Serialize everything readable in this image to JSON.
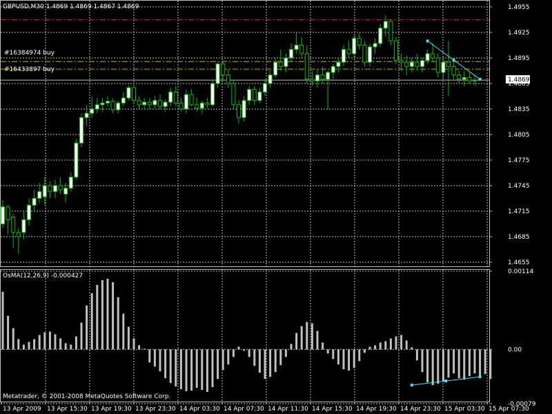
{
  "header": {
    "symbol_text": "GBPUSD,M30  1.4869 1.4869 1.4867 1.4869"
  },
  "orders": [
    {
      "label": "#16384974 buy",
      "price": 1.48905
    },
    {
      "label": "#16433897 buy",
      "price": 1.48815
    }
  ],
  "levels": {
    "red_line": 1.494,
    "current_price": 1.4869,
    "current_price_label": "1.4869"
  },
  "indicator": {
    "title": "OsMA(12,26,9) -0.000427"
  },
  "copyright": "Metatrader, © 2001-2008 MetaQuotes Software Corp.",
  "colors": {
    "background": "#000000",
    "grid": "#c0c0c0",
    "bull_fill": "#ffffff",
    "bear_fill": "#000000",
    "candle_outline": "#00c000",
    "red_level": "#ff0000",
    "order_line": "#00c000",
    "histogram": "#c0c0c0",
    "trend": "#40e0ff"
  },
  "chart_data": [
    {
      "type": "candlestick",
      "symbol": "GBPUSD",
      "timeframe": "M30",
      "ylim": [
        1.4655,
        1.4955
      ],
      "y_ticks": [
        "1.4955",
        "1.4925",
        "1.4895",
        "1.4865",
        "1.4835",
        "1.4805",
        "1.4775",
        "1.4745",
        "1.4715",
        "1.4685",
        "1.4655"
      ],
      "x_ticks": [
        "13 Apr 2009",
        "13 Apr 15:30",
        "13 Apr 19:30",
        "13 Apr 23:30",
        "14 Apr 03:30",
        "14 Apr 07:30",
        "14 Apr 11:30",
        "14 Apr 15:30",
        "14 Apr 19:30",
        "14 Apr 23:30",
        "15 Apr 03:30",
        "15 Apr 07:30"
      ],
      "ohlc": [
        [
          1.47,
          1.4728,
          1.4695,
          1.472
        ],
        [
          1.472,
          1.4722,
          1.4688,
          1.4705
        ],
        [
          1.4708,
          1.4712,
          1.4672,
          1.469
        ],
        [
          1.469,
          1.4695,
          1.4665,
          1.4685
        ],
        [
          1.469,
          1.4715,
          1.4682,
          1.4705
        ],
        [
          1.4705,
          1.473,
          1.4698,
          1.4722
        ],
        [
          1.4722,
          1.474,
          1.4715,
          1.473
        ],
        [
          1.473,
          1.4748,
          1.4725,
          1.4738
        ],
        [
          1.4732,
          1.4755,
          1.4722,
          1.4745
        ],
        [
          1.4745,
          1.475,
          1.473,
          1.4738
        ],
        [
          1.4738,
          1.4752,
          1.473,
          1.4745
        ],
        [
          1.4745,
          1.4755,
          1.4735,
          1.474
        ],
        [
          1.4735,
          1.4748,
          1.4725,
          1.4742
        ],
        [
          1.4742,
          1.476,
          1.4738,
          1.4755
        ],
        [
          1.4755,
          1.48,
          1.4752,
          1.4795
        ],
        [
          1.4795,
          1.483,
          1.479,
          1.4825
        ],
        [
          1.4825,
          1.484,
          1.4815,
          1.483
        ],
        [
          1.483,
          1.485,
          1.4825,
          1.4835
        ],
        [
          1.4835,
          1.4848,
          1.483,
          1.484
        ],
        [
          1.484,
          1.4848,
          1.4832,
          1.4842
        ],
        [
          1.4842,
          1.485,
          1.4838,
          1.4844
        ],
        [
          1.4844,
          1.4848,
          1.483,
          1.4834
        ],
        [
          1.4834,
          1.4845,
          1.483,
          1.4842
        ],
        [
          1.4842,
          1.4855,
          1.4838,
          1.4848
        ],
        [
          1.4848,
          1.4862,
          1.4845,
          1.486
        ],
        [
          1.486,
          1.4865,
          1.4842,
          1.4845
        ],
        [
          1.4845,
          1.485,
          1.4835,
          1.484
        ],
        [
          1.484,
          1.4848,
          1.4835,
          1.4843
        ],
        [
          1.4843,
          1.4848,
          1.4835,
          1.484
        ],
        [
          1.484,
          1.485,
          1.4836,
          1.4845
        ],
        [
          1.4845,
          1.4852,
          1.4835,
          1.4838
        ],
        [
          1.4838,
          1.4846,
          1.4832,
          1.4843
        ],
        [
          1.4843,
          1.486,
          1.4838,
          1.4855
        ],
        [
          1.4855,
          1.4862,
          1.4838,
          1.4842
        ],
        [
          1.4842,
          1.4848,
          1.4832,
          1.4835
        ],
        [
          1.4835,
          1.4858,
          1.483,
          1.4852
        ],
        [
          1.4852,
          1.4858,
          1.4838,
          1.484
        ],
        [
          1.484,
          1.4848,
          1.4832,
          1.4836
        ],
        [
          1.4836,
          1.4845,
          1.483,
          1.4842
        ],
        [
          1.4842,
          1.4848,
          1.4836,
          1.484
        ],
        [
          1.484,
          1.487,
          1.4838,
          1.4865
        ],
        [
          1.4865,
          1.489,
          1.486,
          1.4888
        ],
        [
          1.4888,
          1.4892,
          1.487,
          1.4875
        ],
        [
          1.4875,
          1.4882,
          1.486,
          1.4865
        ],
        [
          1.4865,
          1.487,
          1.4835,
          1.484
        ],
        [
          1.484,
          1.4845,
          1.4818,
          1.4825
        ],
        [
          1.4825,
          1.485,
          1.482,
          1.4845
        ],
        [
          1.4845,
          1.4862,
          1.484,
          1.4858
        ],
        [
          1.4858,
          1.4862,
          1.484,
          1.4845
        ],
        [
          1.4845,
          1.486,
          1.4842,
          1.4855
        ],
        [
          1.4855,
          1.487,
          1.485,
          1.4865
        ],
        [
          1.4865,
          1.488,
          1.486,
          1.4875
        ],
        [
          1.4875,
          1.4895,
          1.4872,
          1.489
        ],
        [
          1.489,
          1.4905,
          1.488,
          1.4885
        ],
        [
          1.4885,
          1.49,
          1.4878,
          1.4895
        ],
        [
          1.4895,
          1.4912,
          1.489,
          1.4905
        ],
        [
          1.4905,
          1.4925,
          1.49,
          1.491
        ],
        [
          1.491,
          1.492,
          1.4895,
          1.49
        ],
        [
          1.49,
          1.491,
          1.4865,
          1.487
        ],
        [
          1.487,
          1.488,
          1.4862,
          1.4868
        ],
        [
          1.4868,
          1.4882,
          1.486,
          1.4875
        ],
        [
          1.4875,
          1.4885,
          1.4865,
          1.487
        ],
        [
          1.487,
          1.488,
          1.4835,
          1.4878
        ],
        [
          1.4878,
          1.4888,
          1.487,
          1.4885
        ],
        [
          1.4885,
          1.4895,
          1.4878,
          1.489
        ],
        [
          1.489,
          1.491,
          1.4885,
          1.4905
        ],
        [
          1.4905,
          1.4915,
          1.4895,
          1.49
        ],
        [
          1.49,
          1.4922,
          1.4895,
          1.4918
        ],
        [
          1.4918,
          1.4925,
          1.4905,
          1.491
        ],
        [
          1.491,
          1.4915,
          1.4885,
          1.489
        ],
        [
          1.489,
          1.4912,
          1.4885,
          1.4908
        ],
        [
          1.4908,
          1.4918,
          1.49,
          1.4912
        ],
        [
          1.4912,
          1.4935,
          1.4908,
          1.493
        ],
        [
          1.493,
          1.4945,
          1.492,
          1.4938
        ],
        [
          1.4938,
          1.494,
          1.491,
          1.4915
        ],
        [
          1.4915,
          1.492,
          1.4888,
          1.4892
        ],
        [
          1.4892,
          1.49,
          1.488,
          1.489
        ],
        [
          1.489,
          1.4898,
          1.4875,
          1.4885
        ],
        [
          1.4885,
          1.4895,
          1.4878,
          1.489
        ],
        [
          1.489,
          1.49,
          1.488,
          1.4885
        ],
        [
          1.4885,
          1.4895,
          1.4878,
          1.4892
        ],
        [
          1.4892,
          1.4905,
          1.4888,
          1.49
        ],
        [
          1.49,
          1.4912,
          1.489,
          1.4895
        ],
        [
          1.4895,
          1.49,
          1.4872,
          1.4878
        ],
        [
          1.4878,
          1.4895,
          1.487,
          1.489
        ],
        [
          1.489,
          1.4915,
          1.485,
          1.4885
        ],
        [
          1.4885,
          1.4892,
          1.487,
          1.4875
        ],
        [
          1.4875,
          1.488,
          1.4865,
          1.487
        ],
        [
          1.487,
          1.488,
          1.4862,
          1.4872
        ],
        [
          1.4872,
          1.4878,
          1.4865,
          1.4868
        ],
        [
          1.4868,
          1.4875,
          1.4862,
          1.4869
        ]
      ]
    },
    {
      "type": "bar",
      "name": "OsMA(12,26,9)",
      "ylim": [
        -0.0007,
        0.0011
      ],
      "y_ticks": [
        "0.00114",
        "0.00",
        "-0.00079"
      ],
      "values": [
        0.00084,
        0.00049,
        0.00031,
        0.00015,
        7e-05,
        0.00011,
        0.00015,
        0.00021,
        0.00025,
        0.00026,
        0.00022,
        0.00016,
        9e-05,
        7e-05,
        0.00019,
        0.00039,
        0.00064,
        0.00082,
        0.00094,
        0.00101,
        0.00103,
        0.00098,
        0.00076,
        0.00052,
        0.00033,
        0.00016,
        6e-05,
        1e-05,
        -0.00019,
        -0.00025,
        -0.00032,
        -0.00042,
        -0.00049,
        -0.00054,
        -0.00058,
        -0.00061,
        -0.0006,
        -0.00056,
        -0.00059,
        -0.00062,
        -0.00055,
        -0.00043,
        -0.0003,
        -0.00022,
        -0.00011,
        4e-05,
        -2e-05,
        -0.00011,
        -0.00024,
        -0.00034,
        -0.00043,
        -0.0004,
        -0.00033,
        -0.00023,
        -0.00011,
        8e-05,
        0.00024,
        0.00034,
        0.0004,
        0.00038,
        0.00027,
        0.0001,
        -6e-05,
        -0.00014,
        -0.00022,
        -0.00029,
        -0.00031,
        -0.00027,
        -0.00017,
        -5e-05,
        4e-05,
        6e-05,
        0.0001,
        0.00012,
        0.00016,
        0.00019,
        0.00021,
        0.00013,
        3e-05,
        -0.00016,
        -0.00033,
        -0.00048,
        -0.00052,
        -0.0005,
        -0.00047,
        -0.00041,
        -0.00035,
        -0.00042,
        -0.00044,
        -0.00039,
        -0.00035,
        -0.0004,
        -0.00036,
        -0.00043
      ]
    }
  ]
}
